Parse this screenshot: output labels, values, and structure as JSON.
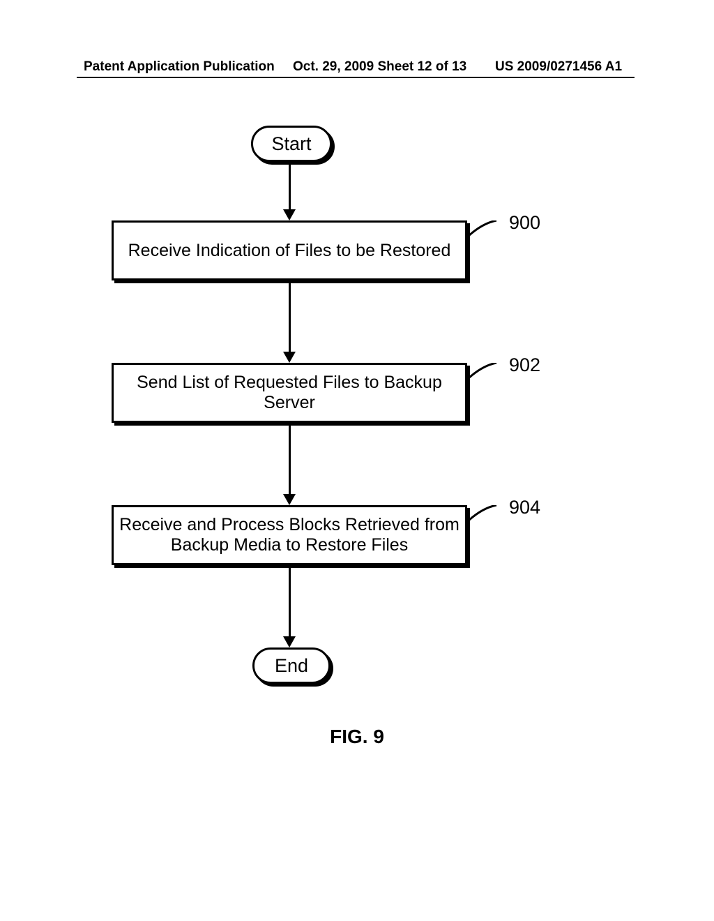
{
  "header": {
    "left": "Patent Application Publication",
    "middle": "Oct. 29, 2009  Sheet 12 of 13",
    "right": "US 2009/0271456 A1"
  },
  "flow": {
    "start": "Start",
    "step900": "Receive Indication of Files to be Restored",
    "step902": "Send List of Requested Files to Backup Server",
    "step904": "Receive and Process Blocks Retrieved from Backup Media to Restore Files",
    "end": "End"
  },
  "refs": {
    "r900": "900",
    "r902": "902",
    "r904": "904"
  },
  "figure_caption": "FIG. 9"
}
